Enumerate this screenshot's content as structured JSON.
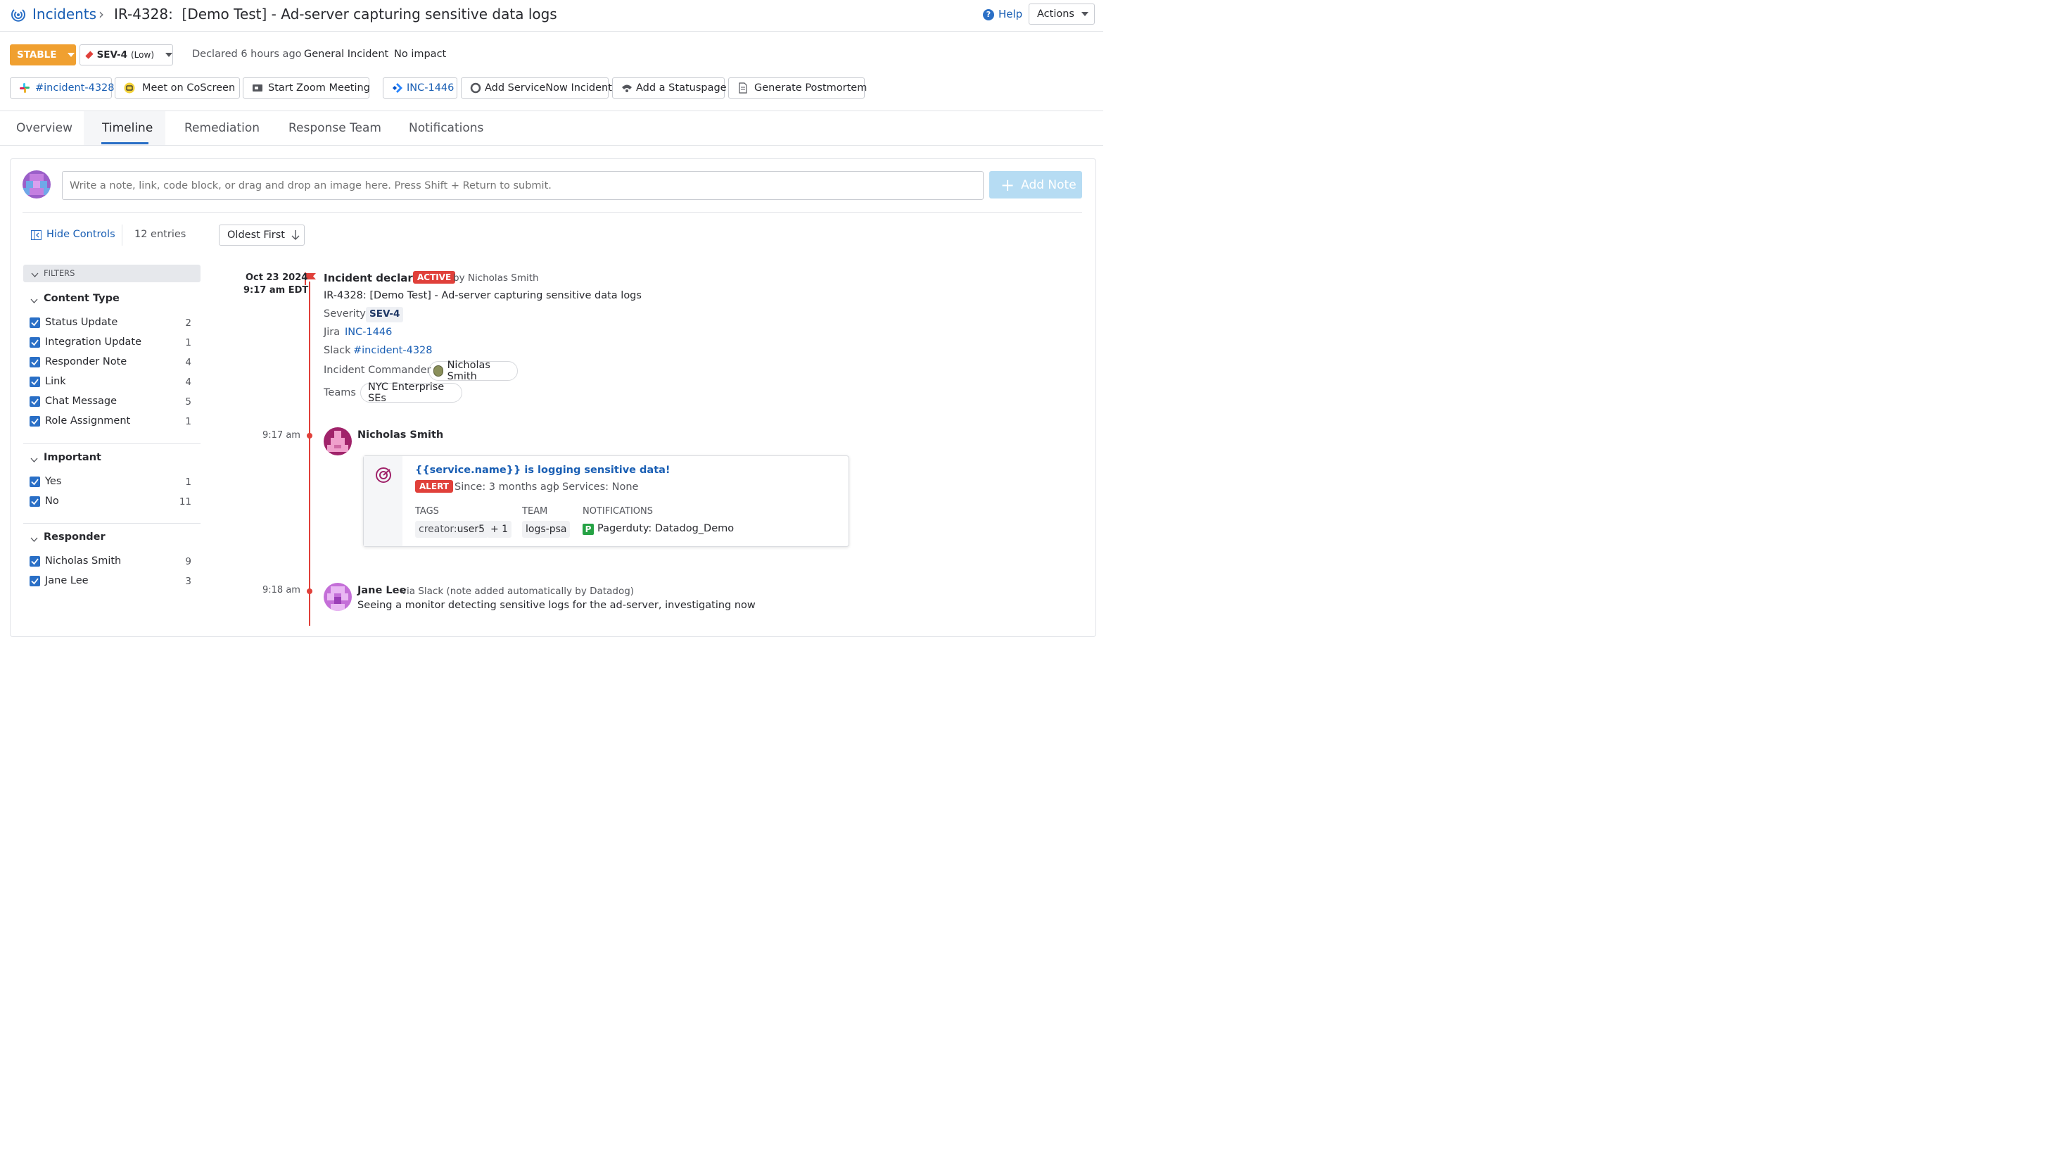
{
  "breadcrumb": {
    "root": "Incidents",
    "separator": "›",
    "title": "IR-4328:  [Demo Test] - Ad-server capturing sensitive data logs"
  },
  "header": {
    "help_label": "Help",
    "actions_label": "Actions"
  },
  "status": {
    "state": "STABLE",
    "severity": "SEV-4",
    "severity_level": "(Low)",
    "declared": "Declared 6 hours ago",
    "type": "General Incident",
    "impact": "No impact"
  },
  "integrations": [
    {
      "label": "#incident-4328",
      "icon": "slack-icon"
    },
    {
      "label": "Meet on CoScreen",
      "icon": "coscreen-icon"
    },
    {
      "label": "Start Zoom Meeting",
      "icon": "zoom-icon"
    },
    {
      "label": "INC-1446",
      "icon": "jira-icon"
    },
    {
      "label": "Add ServiceNow Incident",
      "icon": "servicenow-icon"
    },
    {
      "label": "Add a Statuspage",
      "icon": "statuspage-icon"
    },
    {
      "label": "Generate Postmortem",
      "icon": "document-icon"
    }
  ],
  "tabs": [
    "Overview",
    "Timeline",
    "Remediation",
    "Response Team",
    "Notifications"
  ],
  "active_tab": "Timeline",
  "note": {
    "placeholder": "Write a note, link, code block, or drag and drop an image here. Press Shift + Return to submit.",
    "add_label": "Add Note"
  },
  "controls": {
    "hide_label": "Hide Controls",
    "entries": "12 entries",
    "sort_label": "Oldest First"
  },
  "filters": {
    "title": "FILTERS",
    "groups": [
      {
        "title": "Content Type",
        "items": [
          {
            "label": "Status Update",
            "count": "2"
          },
          {
            "label": "Integration Update",
            "count": "1"
          },
          {
            "label": "Responder Note",
            "count": "4"
          },
          {
            "label": "Link",
            "count": "4"
          },
          {
            "label": "Chat Message",
            "count": "5"
          },
          {
            "label": "Role Assignment",
            "count": "1"
          }
        ]
      },
      {
        "title": "Important",
        "items": [
          {
            "label": "Yes",
            "count": "1"
          },
          {
            "label": "No",
            "count": "11"
          }
        ]
      },
      {
        "title": "Responder",
        "items": [
          {
            "label": "Nicholas Smith",
            "count": "9"
          },
          {
            "label": "Jane Lee",
            "count": "3"
          }
        ]
      }
    ]
  },
  "timeline": {
    "entry1": {
      "date": "Oct 23 2024",
      "time": "9:17 am EDT",
      "title": "Incident declared",
      "badge": "ACTIVE",
      "by": "by Nicholas Smith",
      "summary": "IR-4328: [Demo Test] - Ad-server capturing sensitive data logs",
      "severity_label": "Severity",
      "severity_value": "SEV-4",
      "jira_label": "Jira",
      "jira_value": "INC-1446",
      "slack_label": "Slack",
      "slack_value": "#incident-4328",
      "commander_label": "Incident Commander",
      "commander_value": "Nicholas Smith",
      "teams_label": "Teams",
      "teams_value": "NYC Enterprise SEs"
    },
    "entry2": {
      "time": "9:17 am",
      "author": "Nicholas Smith",
      "monitor_title": "{{service.name}} is logging sensitive data!",
      "alert_badge": "ALERT",
      "since": "Since: 3 months ago",
      "sep": "|",
      "services": "Services: None",
      "tags_label": "TAGS",
      "tag_key": "creator:",
      "tag_value": "user5",
      "tag_more": "+ 1",
      "team_label": "TEAM",
      "team_value": "logs-psa",
      "notif_label": "NOTIFICATIONS",
      "notif_value": "Pagerduty: Datadog_Demo"
    },
    "entry3": {
      "time": "9:18 am",
      "author": "Jane Lee",
      "via": "via Slack (note added automatically by Datadog)",
      "message": "Seeing a monitor detecting sensitive logs for the ad-server, investigating now"
    }
  },
  "colors": {
    "accent": "#1a5fb4",
    "stable": "#f0a030",
    "alert": "#e0403a",
    "timeline": "#e0403a"
  }
}
